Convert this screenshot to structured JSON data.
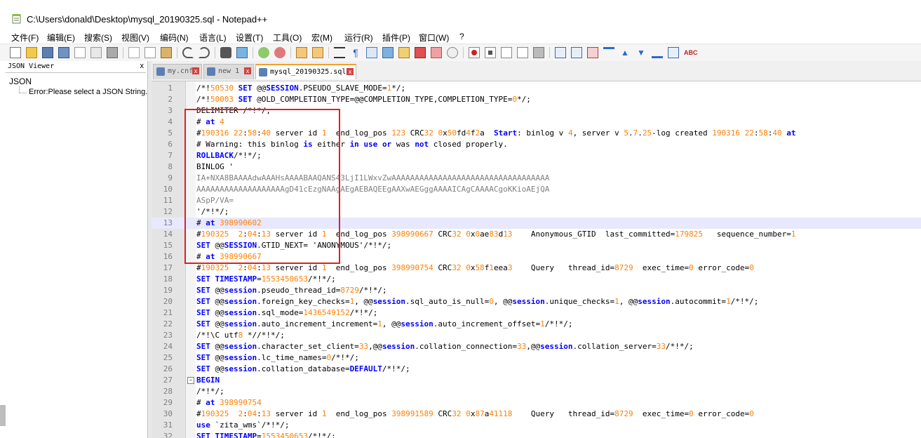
{
  "window": {
    "title": "C:\\Users\\donald\\Desktop\\mysql_20190325.sql - Notepad++"
  },
  "menu": [
    "文件(F)",
    "编辑(E)",
    "搜索(S)",
    "视图(V)",
    "编码(N)",
    "语言(L)",
    "设置(T)",
    "工具(O)",
    "宏(M)",
    "运行(R)",
    "插件(P)",
    "窗口(W)",
    "?"
  ],
  "json_viewer": {
    "title": "JSON Viewer",
    "close": "x",
    "root": "JSON",
    "error": "Error:Please select a JSON String."
  },
  "tabs": [
    {
      "label": "my.cnf",
      "close": "x"
    },
    {
      "label": "new 1",
      "close": "x"
    },
    {
      "label": "mysql_20190325.sql",
      "close": "x"
    }
  ],
  "editor": {
    "current_line": 13,
    "lines": [
      {
        "n": "1",
        "text": "/*!50530 SET @@SESSION.PSEUDO_SLAVE_MODE=1*/;"
      },
      {
        "n": "2",
        "text": "/*!50003 SET @OLD_COMPLETION_TYPE=@@COMPLETION_TYPE,COMPLETION_TYPE=0*/;"
      },
      {
        "n": "3",
        "text": "DELIMITER /*!*/;"
      },
      {
        "n": "4",
        "text": "# at 4"
      },
      {
        "n": "5",
        "text": "#190316 22:58:40 server id 1  end_log_pos 123 CRC32 0x50fd4f2a  Start: binlog v 4, server v 5.7.25-log created 190316 22:58:40 at"
      },
      {
        "n": "6",
        "text": "# Warning: this binlog is either in use or was not closed properly."
      },
      {
        "n": "7",
        "text": "ROLLBACK/*!*/;"
      },
      {
        "n": "8",
        "text": "BINLOG '"
      },
      {
        "n": "9",
        "text": "IA+NXA8BAAAAdwAAAHsAAAABAAQANS43LjI1LWxvZwAAAAAAAAAAAAAAAAAAAAAAAAAAAAAAAAAA"
      },
      {
        "n": "10",
        "text": "AAAAAAAAAAAAAAAAAAAgD41cEzgNAAgAEgAEBAQEEgAAXwAEGggAAAAICAgCAAAACgoKKioAEjQA"
      },
      {
        "n": "11",
        "text": "ASpP/VA="
      },
      {
        "n": "12",
        "text": "'/*!*/;"
      },
      {
        "n": "13",
        "text": "# at 398990602"
      },
      {
        "n": "14",
        "text": "#190325  2:04:13 server id 1  end_log_pos 398990667 CRC32 0x0ae83d13    Anonymous_GTID  last_committed=179825   sequence_number=1"
      },
      {
        "n": "15",
        "text": "SET @@SESSION.GTID_NEXT= 'ANONYMOUS'/*!*/;"
      },
      {
        "n": "16",
        "text": "# at 398990667"
      },
      {
        "n": "17",
        "text": "#190325  2:04:13 server id 1  end_log_pos 398990754 CRC32 0x58f1eea3    Query   thread_id=8729  exec_time=0 error_code=0"
      },
      {
        "n": "18",
        "text": "SET TIMESTAMP=1553450653/*!*/;"
      },
      {
        "n": "19",
        "text": "SET @@session.pseudo_thread_id=8729/*!*/;"
      },
      {
        "n": "20",
        "text": "SET @@session.foreign_key_checks=1, @@session.sql_auto_is_null=0, @@session.unique_checks=1, @@session.autocommit=1/*!*/;"
      },
      {
        "n": "21",
        "text": "SET @@session.sql_mode=1436549152/*!*/;"
      },
      {
        "n": "22",
        "text": "SET @@session.auto_increment_increment=1, @@session.auto_increment_offset=1/*!*/;"
      },
      {
        "n": "23",
        "text": "/*!\\C utf8 *//*!*/;"
      },
      {
        "n": "24",
        "text": "SET @@session.character_set_client=33,@@session.collation_connection=33,@@session.collation_server=33/*!*/;"
      },
      {
        "n": "25",
        "text": "SET @@session.lc_time_names=0/*!*/;"
      },
      {
        "n": "26",
        "text": "SET @@session.collation_database=DEFAULT/*!*/;"
      },
      {
        "n": "27",
        "text": "BEGIN"
      },
      {
        "n": "28",
        "text": "/*!*/;"
      },
      {
        "n": "29",
        "text": "# at 398990754"
      },
      {
        "n": "30",
        "text": "#190325  2:04:13 server id 1  end_log_pos 398991589 CRC32 0x87a41118    Query   thread_id=8729  exec_time=0 error_code=0"
      },
      {
        "n": "31",
        "text": "use `zita_wms`/*!*/;"
      },
      {
        "n": "32",
        "text": "SET TIMESTAMP=1553450653/*!*/;"
      }
    ]
  },
  "colors": {
    "keyword": "#0000ff",
    "number": "#ff8000",
    "base64": "#808080",
    "highlight_box": "#e02020",
    "current_line": "#e8e8ff"
  }
}
